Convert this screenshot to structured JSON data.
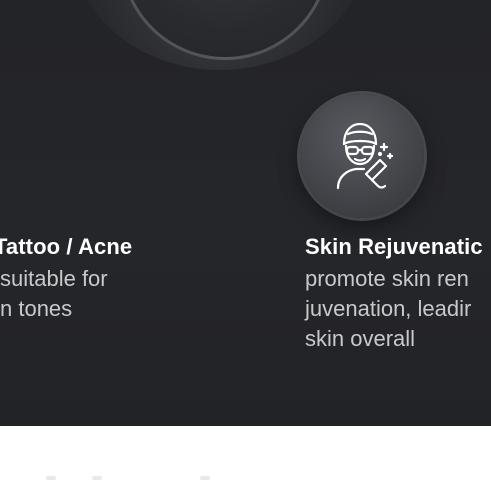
{
  "features": [
    {
      "title": "Tattoo / Acne",
      "description_lines": [
        "suitable for",
        "n tones"
      ]
    },
    {
      "title": "Skin Rejuvenatic",
      "description_lines": [
        "promote skin ren",
        "juvenation, leadir",
        "skin overall"
      ],
      "icon": "skin-treatment-face-icon"
    }
  ],
  "colors": {
    "section_background": "#232428",
    "title_text": "#ffffff",
    "description_text": "#c9c9cc",
    "page_background": "#ffffff"
  }
}
